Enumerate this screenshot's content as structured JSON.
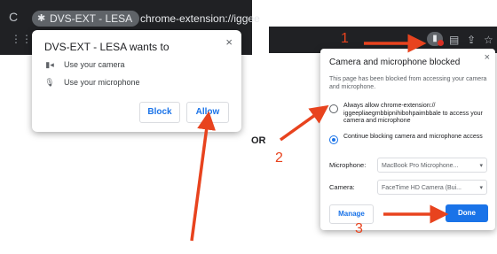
{
  "left_browser": {
    "reload_glyph": "C",
    "extension_chip": "DVS-EXT - LESA",
    "url": "chrome-extension://iggee"
  },
  "left_popup": {
    "title": "DVS-EXT - LESA wants to",
    "close": "×",
    "permissions": [
      "Use your camera",
      "Use your microphone"
    ],
    "block_label": "Block",
    "allow_label": "Allow"
  },
  "separator": "OR",
  "right_popup": {
    "title": "Camera and microphone blocked",
    "close": "×",
    "description": "This page has been blocked from accessing your camera and microphone.",
    "options": [
      {
        "label": "Always allow chrome-extension:// iggeepliaegmbbipnihibohpaimbbale to access your camera and microphone",
        "selected": false
      },
      {
        "label": "Continue blocking camera and microphone access",
        "selected": true
      }
    ],
    "microphone_label": "Microphone:",
    "microphone_value": "MacBook Pro Microphone...",
    "camera_label": "Camera:",
    "camera_value": "FaceTime HD Camera (Bui...",
    "manage_label": "Manage",
    "done_label": "Done"
  },
  "steps": [
    "1",
    "2",
    "3"
  ],
  "colors": {
    "arrow": "#e8431e",
    "accent": "#1a73e8",
    "toolbar": "#202124"
  },
  "icons": [
    "reload-icon",
    "puzzle-icon",
    "camera-icon",
    "microphone-icon",
    "camera-blocked-icon",
    "close-icon",
    "dropdown-caret-icon"
  ]
}
